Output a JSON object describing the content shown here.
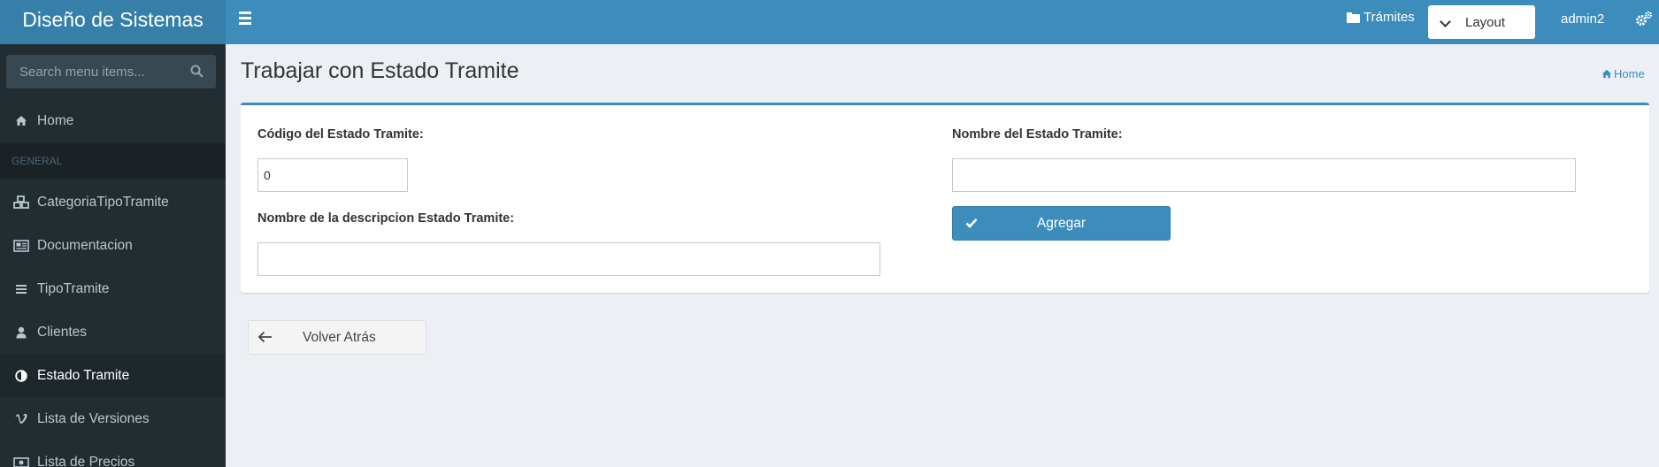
{
  "header": {
    "logo": "Diseño de Sistemas",
    "nav_tramites": "Trámites",
    "layout_label": "Layout",
    "user": "admin2"
  },
  "sidebar": {
    "search_placeholder": "Search menu items...",
    "section_header": "GENERAL",
    "items": [
      {
        "label": "Home",
        "icon": "home-icon"
      },
      {
        "label": "CategoriaTipoTramite",
        "icon": "cubes-icon"
      },
      {
        "label": "Documentacion",
        "icon": "newspaper-icon"
      },
      {
        "label": "TipoTramite",
        "icon": "list-icon"
      },
      {
        "label": "Clientes",
        "icon": "user-icon"
      },
      {
        "label": "Estado Tramite",
        "icon": "adjust-icon",
        "active": true
      },
      {
        "label": "Lista de Versiones",
        "icon": "vimeo-icon"
      },
      {
        "label": "Lista de Precios",
        "icon": "money-icon"
      }
    ]
  },
  "content": {
    "title": "Trabajar con Estado Tramite",
    "breadcrumb": "Home",
    "form": {
      "codigo_label": "Código del Estado Tramite:",
      "codigo_value": "0",
      "nombre_label": "Nombre del Estado Tramite:",
      "nombre_value": "",
      "descripcion_label": "Nombre de la descripcion Estado Tramite:",
      "descripcion_value": "",
      "add_button": "Agregar"
    },
    "back_button": "Volver Atrás"
  },
  "colors": {
    "primary": "#3c8dbc",
    "logo_bg": "#367fa9",
    "sidebar_bg": "#222d32",
    "content_bg": "#ecf0f5"
  }
}
